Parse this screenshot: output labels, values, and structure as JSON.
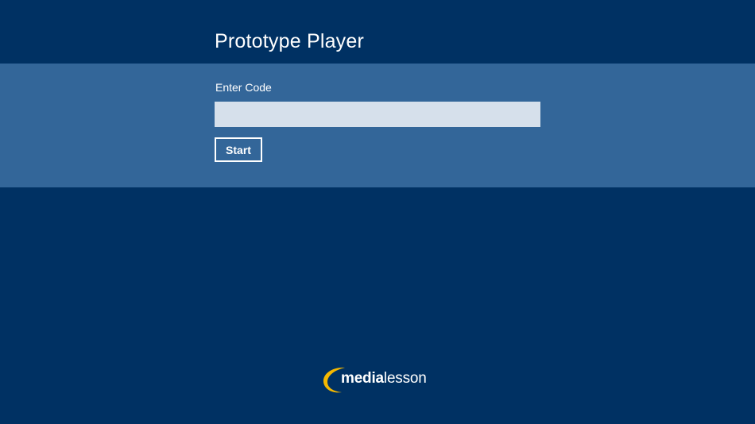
{
  "app": {
    "title": "Prototype Player"
  },
  "form": {
    "code_label": "Enter Code",
    "code_value": "",
    "code_placeholder": "",
    "start_label": "Start"
  },
  "logo": {
    "bold_part": "media",
    "light_part": "lesson",
    "icon": "crescent-swoosh-icon"
  },
  "colors": {
    "background": "#003163",
    "band": "#336699",
    "input_fill": "#d6e0eb",
    "logo_accent": "#f5b800"
  }
}
